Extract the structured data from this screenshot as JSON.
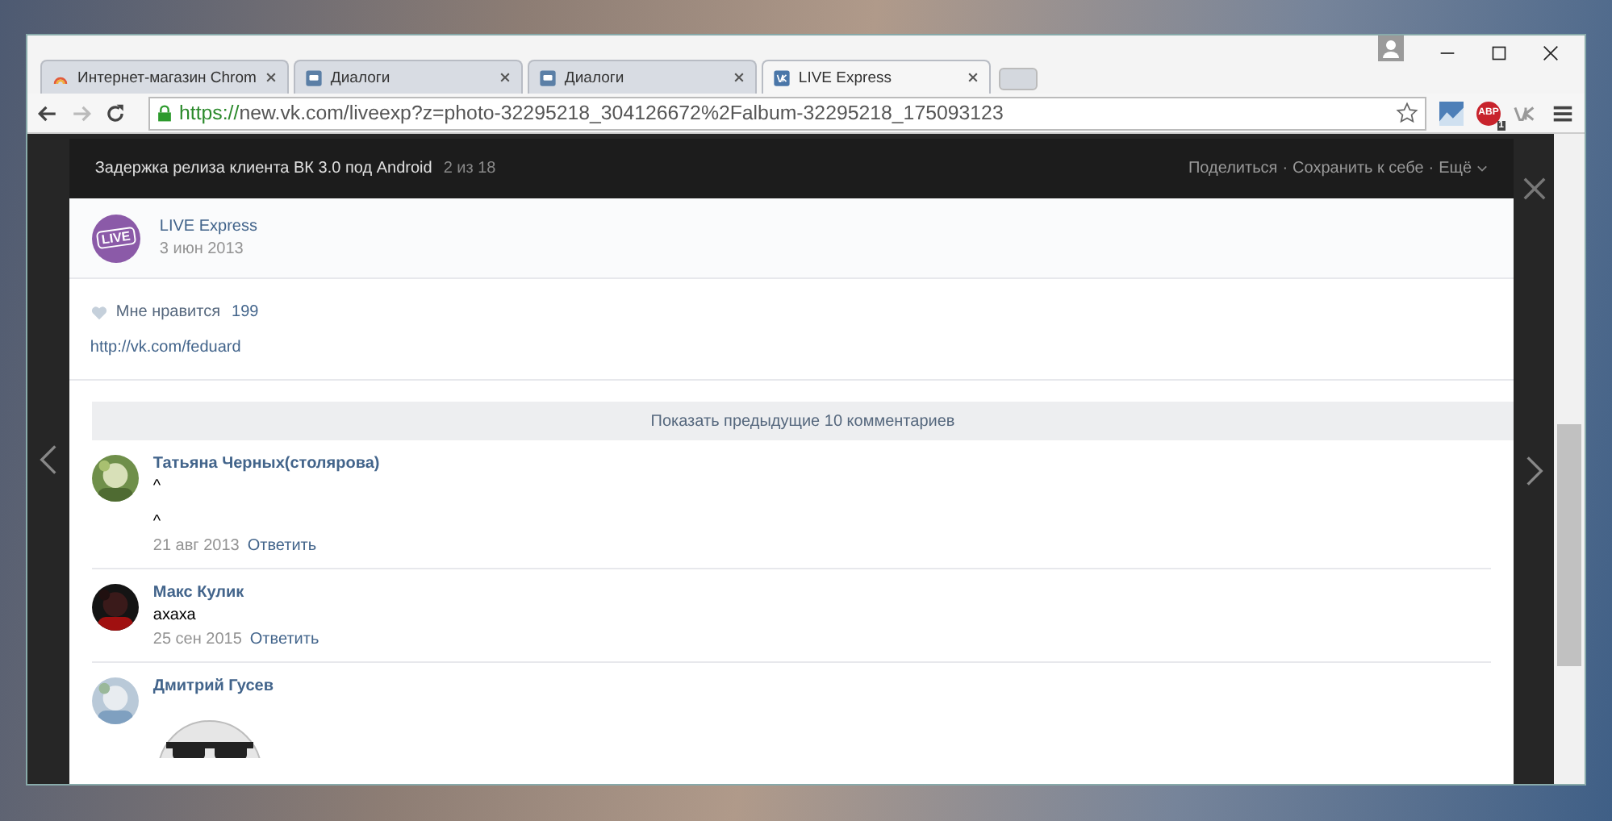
{
  "browser": {
    "tabs": [
      {
        "title": "Интернет-магазин Chrom",
        "kind": "rainbow",
        "selected": false
      },
      {
        "title": "Диалоги",
        "kind": "chat",
        "selected": false
      },
      {
        "title": "Диалоги",
        "kind": "chat",
        "selected": false
      },
      {
        "title": "LIVE Express",
        "kind": "vk",
        "selected": true
      }
    ],
    "address": {
      "scheme": "https://",
      "rest": "new.vk.com/liveexp?z=photo-32295218_304126672%2Falbum-32295218_175093123"
    },
    "abp": {
      "label": "ABP",
      "badge": "1"
    }
  },
  "viewer": {
    "title": "Задержка релиза клиента ВК 3.0 под Android",
    "counter": "2 из 18",
    "separator": "·",
    "actions": [
      "Поделиться",
      "Сохранить к себе",
      "Ещё"
    ]
  },
  "post": {
    "author": "LIVE Express",
    "avatar_text": "LIVE",
    "date": "3 июн 2013",
    "likes": {
      "label": "Мне нравится",
      "count": "199",
      "liked": false
    },
    "link": "http://vk.com/feduard"
  },
  "show_more": "Показать предыдущие 10 комментариев",
  "comments": [
    {
      "name": "Татьяна Черных(столярова)",
      "text": "^\n\n^",
      "date": "21 авг 2013",
      "reply": "Ответить",
      "kind": "text"
    },
    {
      "name": "Макс Кулик",
      "text": "ахаха",
      "date": "25 сен 2015",
      "reply": "Ответить",
      "kind": "text"
    },
    {
      "name": "Дмитрий Гусев",
      "kind": "sticker"
    }
  ]
}
